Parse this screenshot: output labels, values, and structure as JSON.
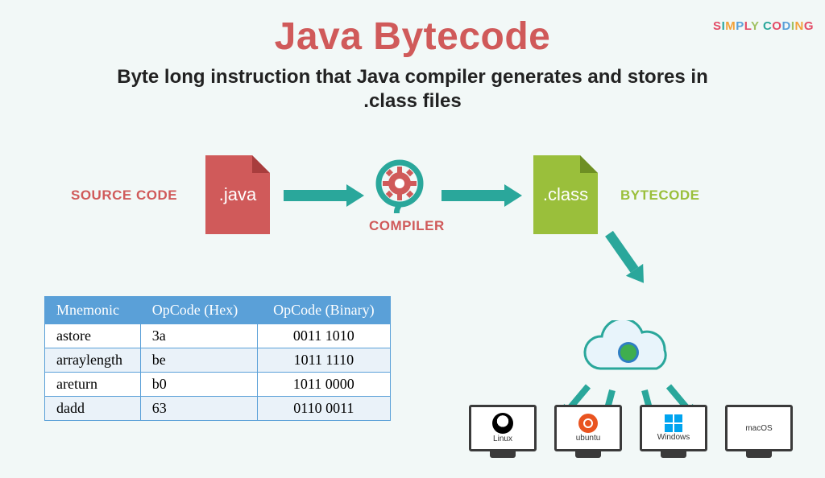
{
  "brand_text": "SIMPLY CODING",
  "title": "Java Bytecode",
  "subtitle": "Byte long instruction that Java compiler generates and stores in .class files",
  "flow": {
    "source_label": "SOURCE CODE",
    "java_file": ".java",
    "compiler_label": "COMPILER",
    "class_file": ".class",
    "bytecode_label": "BYTECODE"
  },
  "table": {
    "headers": [
      "Mnemonic",
      "OpCode (Hex)",
      "OpCode (Binary)"
    ],
    "rows": [
      {
        "mnemonic": "astore",
        "hex": "3a",
        "bin": "0011 1010"
      },
      {
        "mnemonic": "arraylength",
        "hex": "be",
        "bin": "1011 1110"
      },
      {
        "mnemonic": "areturn",
        "hex": "b0",
        "bin": "1011 0000"
      },
      {
        "mnemonic": "dadd",
        "hex": "63",
        "bin": "0110 0011"
      }
    ]
  },
  "platforms": [
    {
      "name": "Linux",
      "icon": "linux-icon"
    },
    {
      "name": "ubuntu",
      "icon": "ubuntu-icon"
    },
    {
      "name": "Windows",
      "icon": "windows-icon"
    },
    {
      "name": "macOS",
      "icon": "macos-icon"
    }
  ],
  "colors": {
    "accent_red": "#d05a5a",
    "accent_green": "#9abf3b",
    "accent_teal": "#2aa79b",
    "table_blue": "#5aa0d8"
  }
}
